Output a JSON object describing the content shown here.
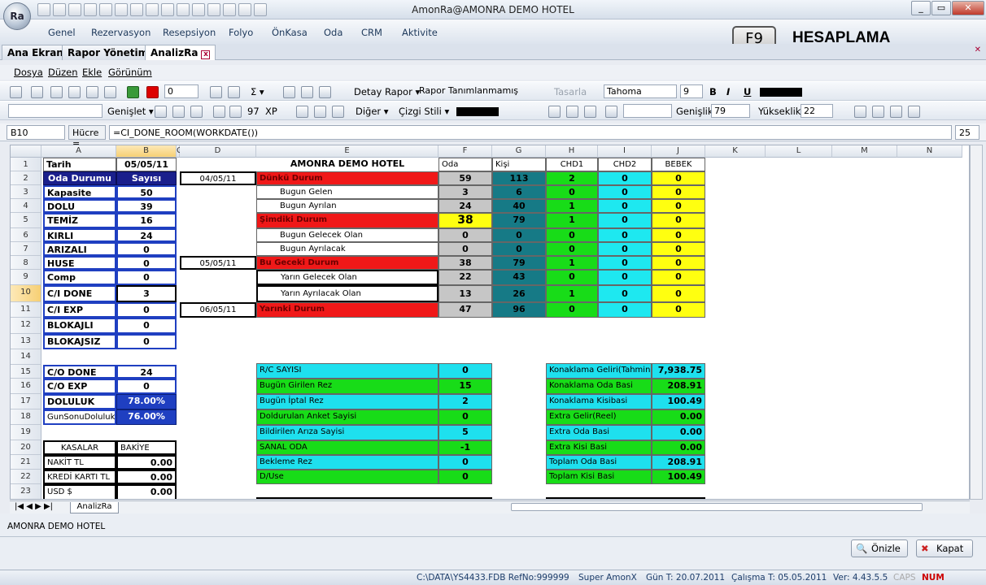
{
  "app": {
    "logo": "Ra",
    "title": "AmonRa@AMONRA DEMO HOTEL",
    "win_min": "_",
    "win_max": "▭",
    "win_close": "✕"
  },
  "menu": {
    "items": [
      "Genel",
      "Rezervasyon",
      "Resepsiyon",
      "Folyo",
      "ÖnKasa",
      "Oda",
      "CRM",
      "Aktivite"
    ]
  },
  "f9": {
    "key": "F9",
    "label": "HESAPLAMA"
  },
  "tabs": [
    "Ana Ekran",
    "Rapor Yönetim",
    "AnalizRa"
  ],
  "menu2": [
    "Dosya",
    "Düzen",
    "Ekle",
    "Görünüm"
  ],
  "toolbar1": {
    "num": "0",
    "report": "Detay Rapor",
    "report_name": "Rapor Tanımlanmamış",
    "design": "Tasarla",
    "font": "Tahoma",
    "size": "9",
    "bold": "B",
    "italic": "I",
    "underline": "U"
  },
  "toolbar2": {
    "expand": "Genişlet",
    "num": "97",
    "xp": "XP",
    "other": "Diğer",
    "linestyle": "Çizgi Stili",
    "width_label": "Genişlik",
    "width_val": "79",
    "height_label": "Yükseklik",
    "height_val": "22"
  },
  "formula": {
    "cell": "B10",
    "label": "Hücre =",
    "value": "=CI_DONE_ROOM(WORKDATE())",
    "zoom": "25"
  },
  "columns": [
    "A",
    "B",
    "C",
    "D",
    "E",
    "F",
    "G",
    "H",
    "I",
    "J",
    "K",
    "L",
    "M",
    "N"
  ],
  "rows": [
    "1",
    "2",
    "3",
    "4",
    "5",
    "6",
    "7",
    "8",
    "9",
    "10",
    "11",
    "12",
    "13",
    "14",
    "15",
    "16",
    "17",
    "18",
    "19",
    "20",
    "21",
    "22",
    "23"
  ],
  "left": {
    "r1": [
      "Tarih",
      "05/05/11"
    ],
    "r2": [
      "Oda Durumu",
      "Sayısı"
    ],
    "items": [
      [
        "Kapasite",
        "50"
      ],
      [
        "DOLU",
        "39"
      ],
      [
        "TEMİZ",
        "16"
      ],
      [
        "KIRLI",
        "24"
      ],
      [
        "ARIZALI",
        "0"
      ],
      [
        "HUSE",
        "0"
      ],
      [
        "Comp",
        "0"
      ],
      [
        "C/I DONE",
        "3"
      ],
      [
        "C/I EXP",
        "0"
      ],
      [
        "BLOKAJLI",
        "0"
      ],
      [
        "BLOKAJSIZ",
        "0"
      ]
    ],
    "co": [
      [
        "C/O DONE",
        "24"
      ],
      [
        "C/O EXP",
        "0"
      ],
      [
        "DOLULUK",
        "78.00%"
      ],
      [
        "GunSonuDoluluk",
        "76.00%"
      ]
    ],
    "kasa": [
      [
        "KASALAR",
        "BAKİYE"
      ],
      [
        "NAKİT TL",
        "0.00"
      ],
      [
        "KREDİ KARTI TL",
        "0.00"
      ],
      [
        "USD $",
        "0.00"
      ]
    ]
  },
  "main": {
    "title": "AMONRA DEMO HOTEL",
    "headers": [
      "Oda",
      "Kişi",
      "CHD1",
      "CHD2",
      "BEBEK"
    ],
    "dates": [
      "04/05/11",
      "05/05/11",
      "06/05/11"
    ],
    "rows": [
      {
        "label": "Dünkü Durum",
        "v": [
          "59",
          "113",
          "2",
          "0",
          "0"
        ]
      },
      {
        "label": "Bugun Gelen",
        "v": [
          "3",
          "6",
          "0",
          "0",
          "0"
        ]
      },
      {
        "label": "Bugun Ayrılan",
        "v": [
          "24",
          "40",
          "1",
          "0",
          "0"
        ]
      },
      {
        "label": "Şimdiki Durum",
        "v": [
          "38",
          "79",
          "1",
          "0",
          "0"
        ]
      },
      {
        "label": "Bugun Gelecek Olan",
        "v": [
          "0",
          "0",
          "0",
          "0",
          "0"
        ]
      },
      {
        "label": "Bugun Ayrılacak",
        "v": [
          "0",
          "0",
          "0",
          "0",
          "0"
        ]
      },
      {
        "label": "Bu Geceki Durum",
        "v": [
          "38",
          "79",
          "1",
          "0",
          "0"
        ]
      },
      {
        "label": "Yarın Gelecek Olan",
        "v": [
          "22",
          "43",
          "0",
          "0",
          "0"
        ]
      },
      {
        "label": "Yarın Ayrılacak Olan",
        "v": [
          "13",
          "26",
          "1",
          "0",
          "0"
        ]
      },
      {
        "label": "Yarınki Durum",
        "v": [
          "47",
          "96",
          "0",
          "0",
          "0"
        ]
      }
    ]
  },
  "stats": [
    [
      "R/C SAYISI",
      "0"
    ],
    [
      "Bugün Girilen Rez",
      "15"
    ],
    [
      "Bugün İptal Rez",
      "2"
    ],
    [
      "Doldurulan Anket Sayisi",
      "0"
    ],
    [
      "Bildirilen Arıza Sayisi",
      "5"
    ],
    [
      "SANAL ODA",
      "-1"
    ],
    [
      "Bekleme Rez",
      "0"
    ],
    [
      "D/Use",
      "0"
    ]
  ],
  "revenue": [
    [
      "Konaklama Geliri(Tahmini)",
      "7,938.75"
    ],
    [
      "Konaklama Oda Basi",
      "208.91"
    ],
    [
      "Konaklama Kisibasi",
      "100.49"
    ],
    [
      "Extra Gelir(Reel)",
      "0.00"
    ],
    [
      "Extra Oda Basi",
      "0.00"
    ],
    [
      "Extra Kisi Basi",
      "0.00"
    ],
    [
      "Toplam Oda Basi",
      "208.91"
    ],
    [
      "Toplam Kisi Basi",
      "100.49"
    ]
  ],
  "sheet_tab": "AnalizRa",
  "hotel_name": "AMONRA DEMO HOTEL",
  "buttons": {
    "preview": "Önizle",
    "close": "Kapat"
  },
  "status": {
    "path": "C:\\DATA\\YS4433.FDB RefNo:999999",
    "user": "Super AmonX",
    "gun": "Gün T: 20.07.2011",
    "calisma": "Çalışma T: 05.05.2011",
    "ver": "Ver: 4.43.5.5",
    "caps": "CAPS",
    "num": "NUM"
  }
}
